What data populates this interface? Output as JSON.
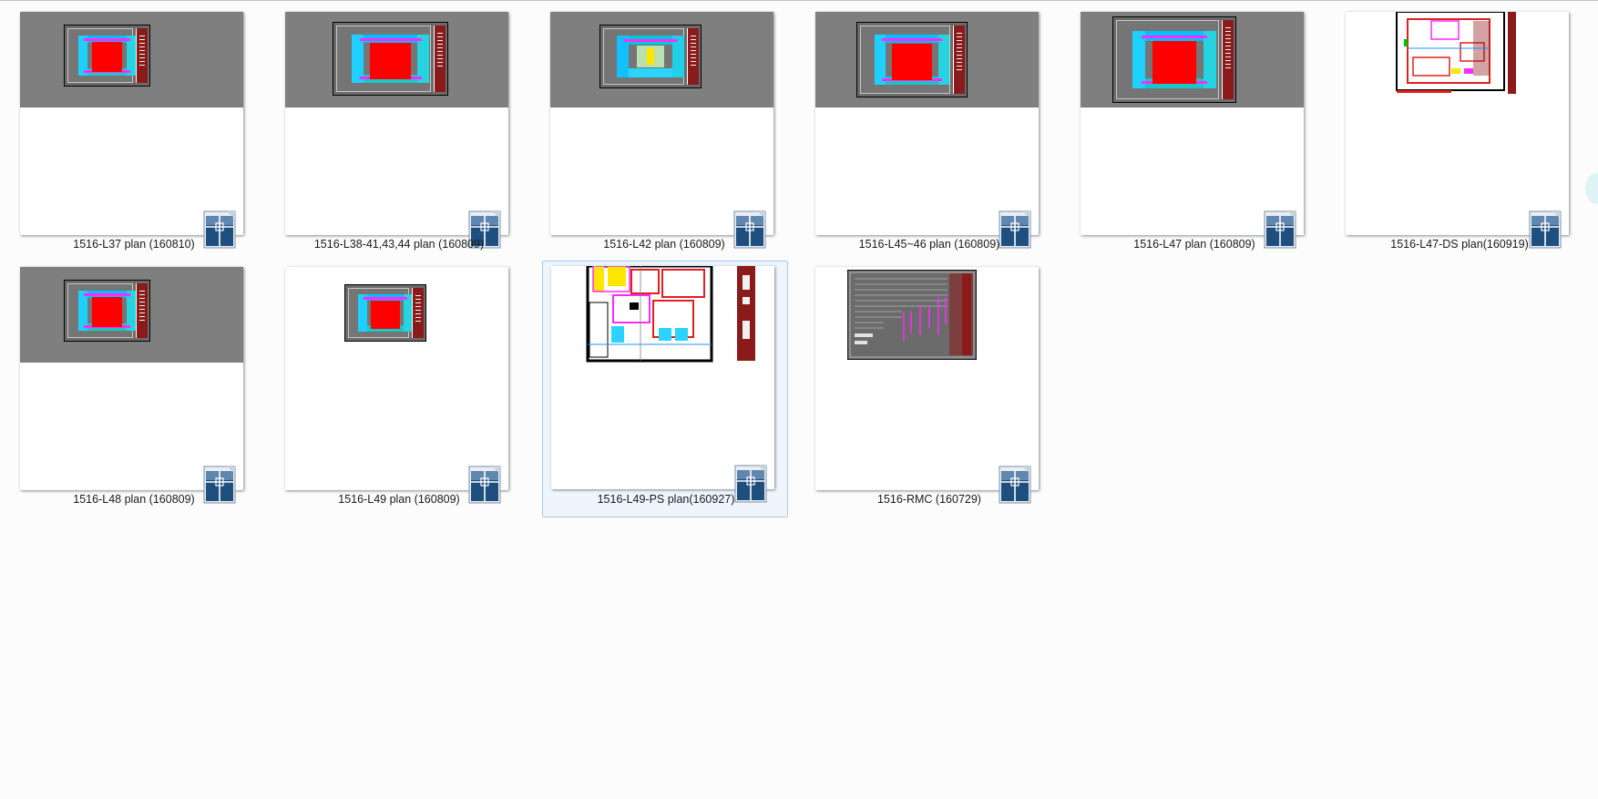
{
  "files": [
    {
      "name": "1516-L37 plan (160810)",
      "kind": "tower"
    },
    {
      "name": "1516-L38-41,43,44 plan (160809)",
      "kind": "tower"
    },
    {
      "name": "1516-L42 plan (160809)",
      "kind": "tower-alt"
    },
    {
      "name": "1516-L45~46 plan (160809)",
      "kind": "tower"
    },
    {
      "name": "1516-L47 plan (160809)",
      "kind": "tower"
    },
    {
      "name": "1516-L47-DS plan(160919)",
      "kind": "detail"
    },
    {
      "name": "1516-L48 plan (160809)",
      "kind": "tower"
    },
    {
      "name": "1516-L49 plan (160809)",
      "kind": "small"
    },
    {
      "name": "1516-L49-PS plan(160927)",
      "kind": "zoom",
      "selected": true
    },
    {
      "name": "1516-RMC (160729)",
      "kind": "schedule"
    }
  ],
  "icon": "autocad-dwg-file-icon",
  "colors": {
    "accent": "#1f4f7f",
    "selection_fill": "#eef5fd",
    "selection_border": "#a9cbee",
    "gray_band": "#7f7f7f",
    "core_red": "#ff0000"
  }
}
